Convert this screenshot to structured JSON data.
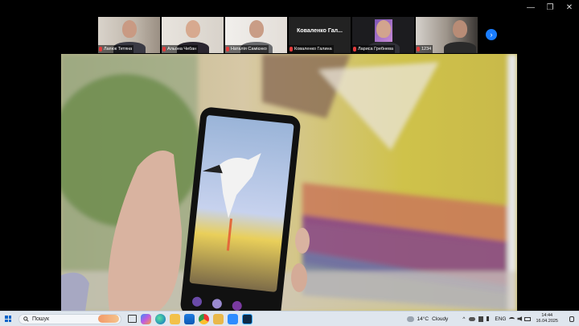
{
  "window": {
    "minimize_icon": "—",
    "restore_icon": "❐",
    "close_icon": "✕"
  },
  "participants": [
    {
      "name": "Лапюк Тетяна",
      "speaking": false,
      "video": true
    },
    {
      "name": "Альона Чебан",
      "speaking": true,
      "video": true
    },
    {
      "name": "Наталія Самієнко",
      "speaking": false,
      "video": true
    },
    {
      "name": "Коваленко Галина",
      "display_name_large": "Коваленко  Гал...",
      "speaking": false,
      "video": false
    },
    {
      "name": "Лариса Гребнева",
      "speaking": false,
      "video": true
    },
    {
      "name": "1234",
      "speaking": false,
      "video": true
    }
  ],
  "next_page_icon": "›",
  "taskbar": {
    "search_label": "Пошук",
    "weather_temp": "14°C",
    "weather_desc": "Cloudy",
    "language": "ENG",
    "time": "14:44",
    "date": "16.04.2025",
    "chevron_icon": "^"
  },
  "colors": {
    "accent": "#1a7dff",
    "speaking": "#3ad17a",
    "mic_muted": "#e43c3c"
  }
}
